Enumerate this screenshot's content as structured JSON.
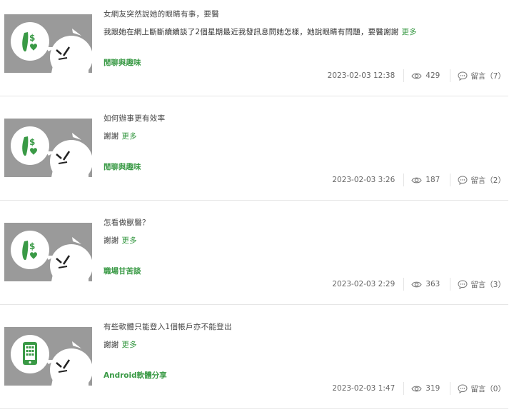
{
  "posts": [
    {
      "title": "女網友突然說她的眼睛有事，要醫",
      "excerpt": "我跟她在網上斷斷續續談了2個星期最近我發訊息問她怎樣，她說眼睛有問題，要醫謝謝",
      "more_label": "更多",
      "category": "閒聊與趣味",
      "date": "2023-02-03 12:38",
      "views": "429",
      "comments_label": "留言（7）",
      "thumb_icon": "taiwan-heart-icon"
    },
    {
      "title": "如何辦事更有效率",
      "excerpt": "謝謝",
      "more_label": "更多",
      "category": "閒聊與趣味",
      "date": "2023-02-03 3:26",
      "views": "187",
      "comments_label": "留言（2）",
      "thumb_icon": "taiwan-heart-icon"
    },
    {
      "title": "怎看做獸醫？",
      "excerpt": "謝謝",
      "more_label": "更多",
      "category": "職場甘苦談",
      "date": "2023-02-03 2:29",
      "views": "363",
      "comments_label": "留言（3）",
      "thumb_icon": "taiwan-heart-icon"
    },
    {
      "title": "有些軟體只能登入1個帳戶亦不能登出",
      "excerpt": "謝謝",
      "more_label": "更多",
      "category": "Android軟體分享",
      "date": "2023-02-03 1:47",
      "views": "319",
      "comments_label": "留言（0）",
      "thumb_icon": "phone-icon"
    }
  ],
  "colors": {
    "accent": "#3a9a46",
    "thumb_bg": "#9a9a9a",
    "meta_text": "#666666",
    "divider": "#e6e6e6"
  }
}
